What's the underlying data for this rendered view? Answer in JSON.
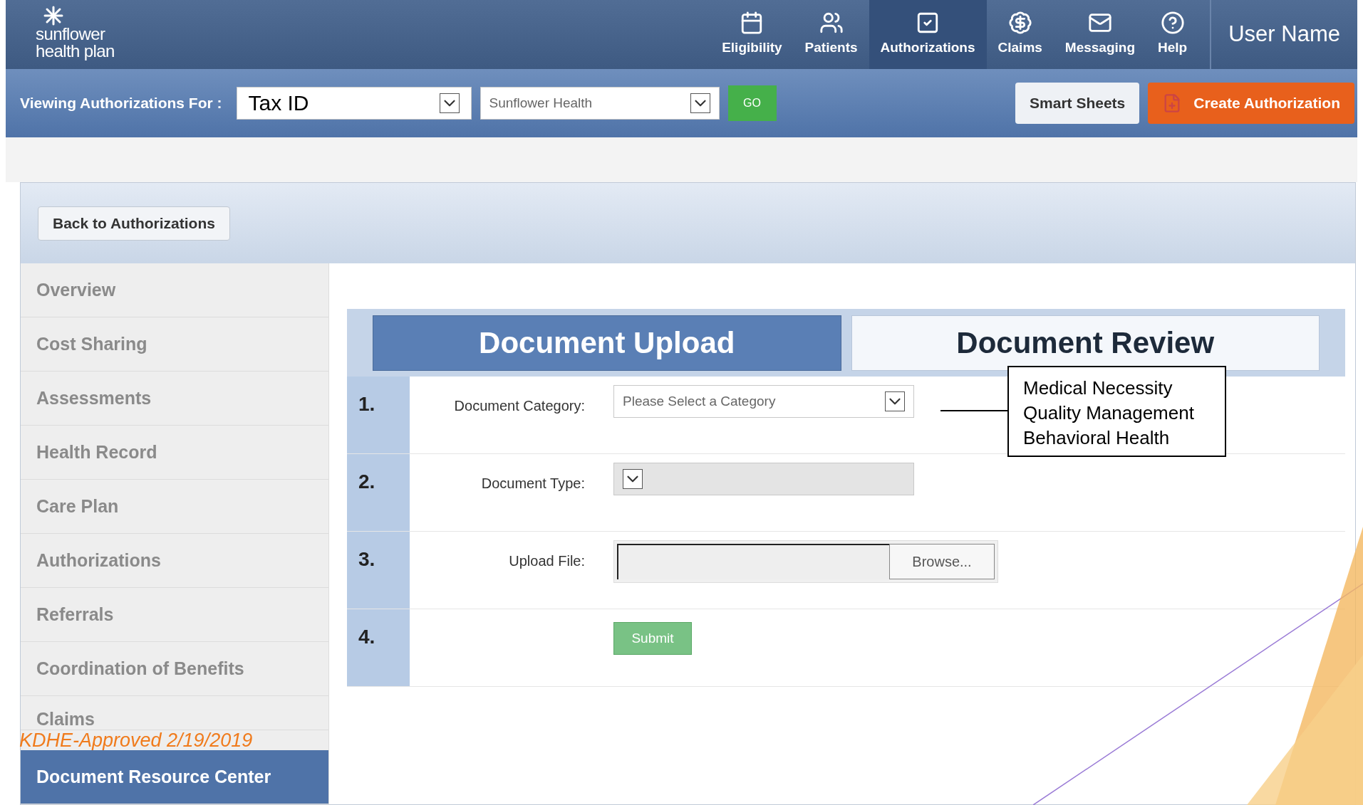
{
  "logo": {
    "line_1": "sunflower",
    "line_2": "health plan"
  },
  "nav": [
    {
      "label": "Eligibility",
      "selected": false
    },
    {
      "label": "Patients",
      "selected": false
    },
    {
      "label": "Authorizations",
      "selected": true
    },
    {
      "label": "Claims",
      "selected": false
    },
    {
      "label": "Messaging",
      "selected": false
    },
    {
      "label": "Help",
      "selected": false
    }
  ],
  "user_name": "User Name",
  "toolbar": {
    "label": "Viewing Authorizations For :",
    "tax_select": "Tax ID",
    "plan_select": "Sunflower Health",
    "go": "GO",
    "smart_sheets": "Smart Sheets",
    "create": "Create Authorization"
  },
  "back_button": "Back to Authorizations",
  "sidebar": [
    {
      "label": "Overview",
      "selected": false
    },
    {
      "label": "Cost Sharing",
      "selected": false
    },
    {
      "label": "Assessments",
      "selected": false
    },
    {
      "label": "Health Record",
      "selected": false
    },
    {
      "label": "Care Plan",
      "selected": false
    },
    {
      "label": "Authorizations",
      "selected": false
    },
    {
      "label": "Referrals",
      "selected": false
    },
    {
      "label": "Coordination of Benefits",
      "selected": false
    },
    {
      "label": "Claims",
      "selected": false
    },
    {
      "label": "Document Resource Center",
      "selected": true
    }
  ],
  "approval_note": "KDHE-Approved 2/19/2019",
  "tabs": [
    {
      "label": "Document Upload",
      "selected": true
    },
    {
      "label": "Document Review",
      "selected": false
    }
  ],
  "steps": [
    {
      "number": "1.",
      "kind": "select",
      "label": "Document Category:",
      "value": "Please Select a Category",
      "disabled": false
    },
    {
      "number": "2.",
      "kind": "select",
      "label": "Document Type:",
      "disabled": true
    },
    {
      "number": "3.",
      "kind": "file",
      "label": "Upload File:",
      "button": "Browse..."
    },
    {
      "number": "4.",
      "kind": "submit",
      "button": "Submit"
    }
  ],
  "callout": [
    "Medical Necessity",
    "Quality Management",
    "Behavioral Health"
  ]
}
